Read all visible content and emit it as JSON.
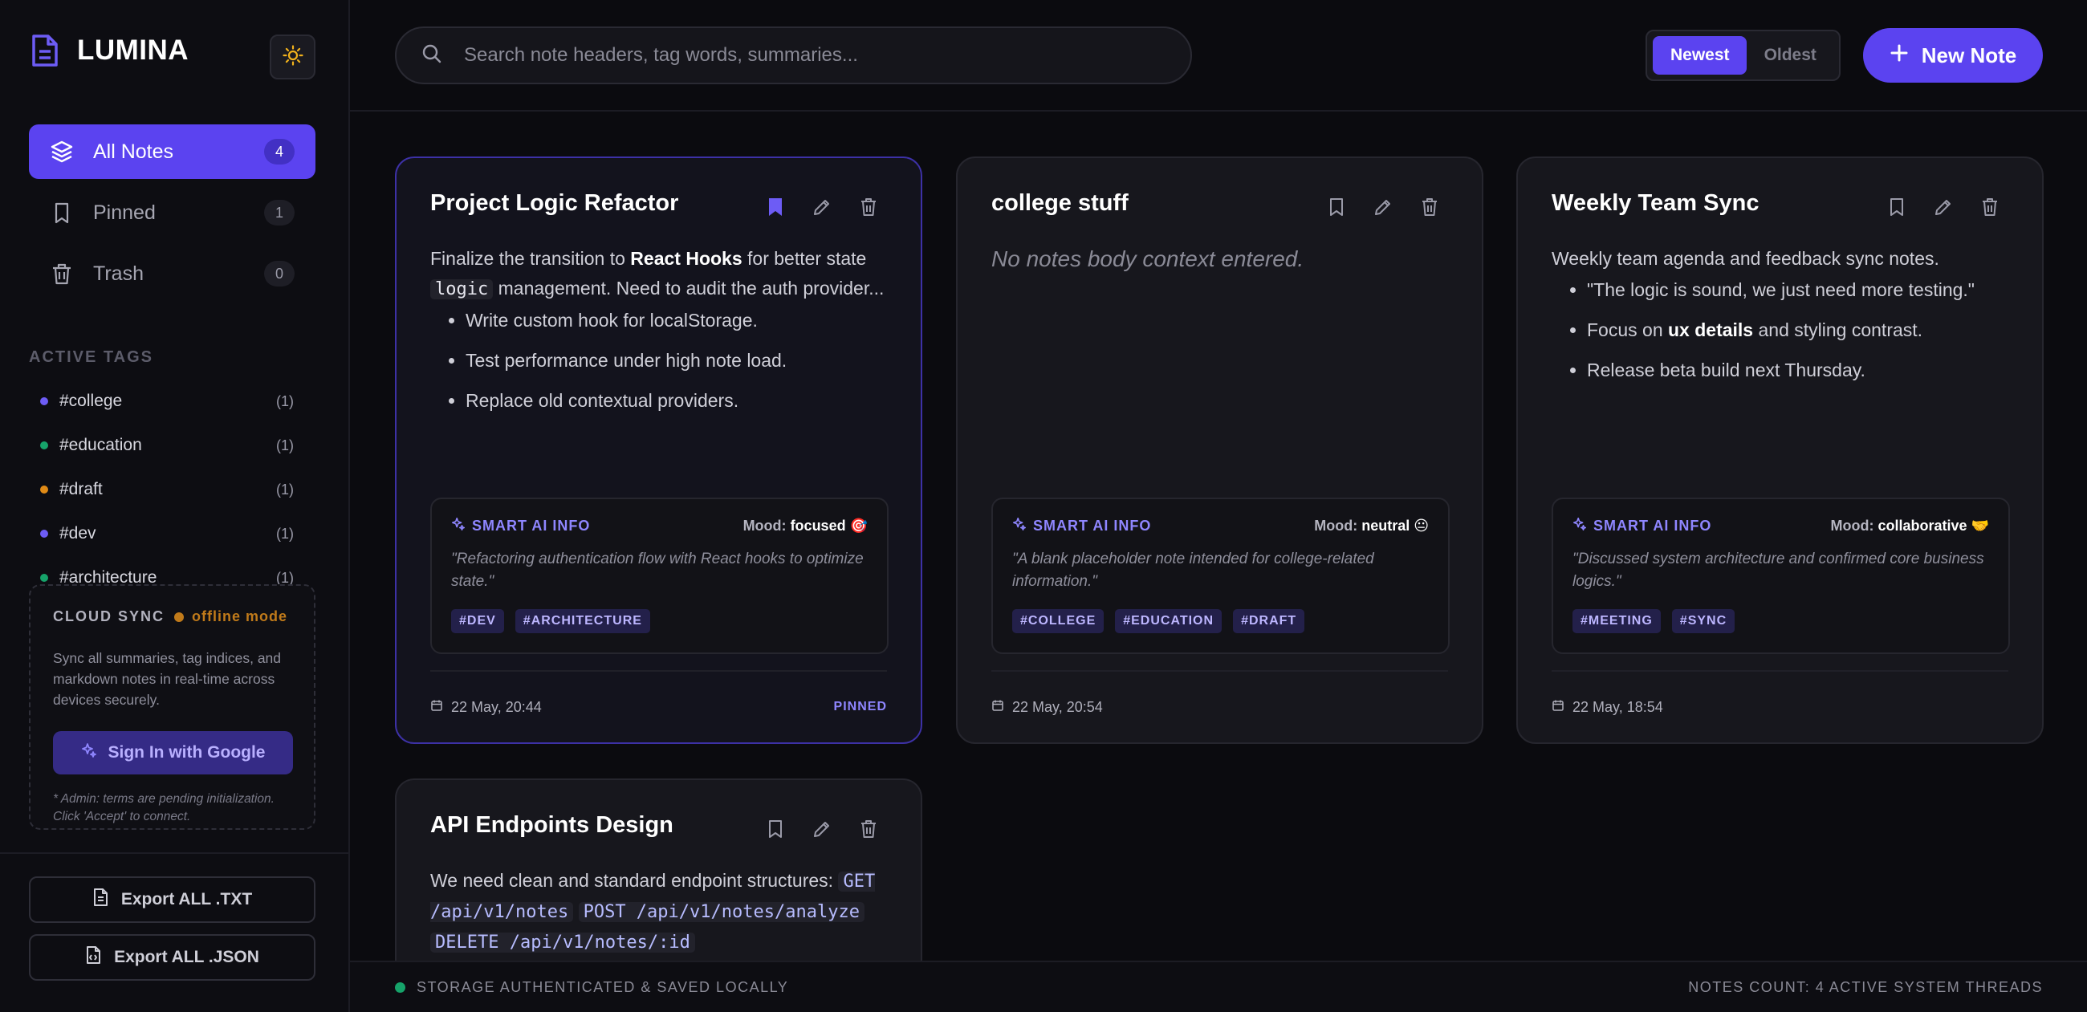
{
  "app": {
    "name": "LUMINA",
    "accent_color": "#5b43f0"
  },
  "sidebar": {
    "nav": [
      {
        "label": "All Notes",
        "count": "4",
        "icon": "layers-icon",
        "active": true
      },
      {
        "label": "Pinned",
        "count": "1",
        "icon": "bookmark-icon",
        "active": false
      },
      {
        "label": "Trash",
        "count": "0",
        "icon": "trash-icon",
        "active": false
      }
    ],
    "tags_heading": "ACTIVE TAGS",
    "tags": [
      {
        "name": "#college",
        "count": "(1)",
        "color": "#6d5cf5"
      },
      {
        "name": "#education",
        "count": "(1)",
        "color": "#16a36a"
      },
      {
        "name": "#draft",
        "count": "(1)",
        "color": "#e08a16"
      },
      {
        "name": "#dev",
        "count": "(1)",
        "color": "#6d5cf5"
      },
      {
        "name": "#architecture",
        "count": "(1)",
        "color": "#16a36a"
      }
    ],
    "sync": {
      "title": "CLOUD SYNC",
      "mode": "offline mode",
      "description": "Sync all summaries, tag indices, and markdown notes in real-time across devices securely.",
      "button": "Sign In with Google",
      "note": "* Admin: terms are pending initialization. Click 'Accept' to connect."
    },
    "export_txt": "Export ALL .TXT",
    "export_json": "Export ALL .JSON"
  },
  "header": {
    "search_placeholder": "Search note headers, tag words, summaries...",
    "sort_newest": "Newest",
    "sort_oldest": "Oldest",
    "new_note": "New Note"
  },
  "ai_label": "SMART AI INFO",
  "mood_label": "Mood:",
  "notes": [
    {
      "title": "Project Logic Refactor",
      "body_intro": "Finalize the transition to ",
      "body_bold": "React Hooks",
      "body_mid": " for better state ",
      "body_code": "logic",
      "body_end": " management. Need to audit the auth provider...",
      "list": [
        "Write custom hook for localStorage.",
        "Test performance under high note load.",
        "Replace old contextual providers."
      ],
      "mood": "focused 🎯",
      "summary": "\"Refactoring authentication flow with React hooks to optimize state.\"",
      "tags": [
        "#DEV",
        "#ARCHITECTURE"
      ],
      "date": "22 May, 20:44",
      "pinned_label": "PINNED"
    },
    {
      "title": "college stuff",
      "empty_body": "No notes body context entered.",
      "mood": "neutral 😐",
      "summary": "\"A blank placeholder note intended for college-related information.\"",
      "tags": [
        "#COLLEGE",
        "#EDUCATION",
        "#DRAFT"
      ],
      "date": "22 May, 20:54"
    },
    {
      "title": "Weekly Team Sync",
      "body_intro": "Weekly team agenda and feedback sync notes.",
      "list_0": "\"The logic is sound, we just need more testing.\"",
      "list_1_a": "Focus on ",
      "list_1_b": "ux details",
      "list_1_c": " and styling contrast.",
      "list_2": "Release beta build next Thursday.",
      "mood": "collaborative 🤝",
      "summary": "\"Discussed system architecture and confirmed core business logics.\"",
      "tags": [
        "#MEETING",
        "#SYNC"
      ],
      "date": "22 May, 18:54"
    },
    {
      "title": "API Endpoints Design",
      "body_intro": "We need clean and standard endpoint structures: ",
      "code_0": "GET /api/v1/notes",
      "code_1": "POST /api/v1/notes/analyze",
      "code_2": "DELETE /api/v1/notes/:id"
    }
  ],
  "status": {
    "left": "STORAGE AUTHENTICATED & SAVED LOCALLY",
    "right": "NOTES COUNT: 4 ACTIVE SYSTEM THREADS"
  }
}
